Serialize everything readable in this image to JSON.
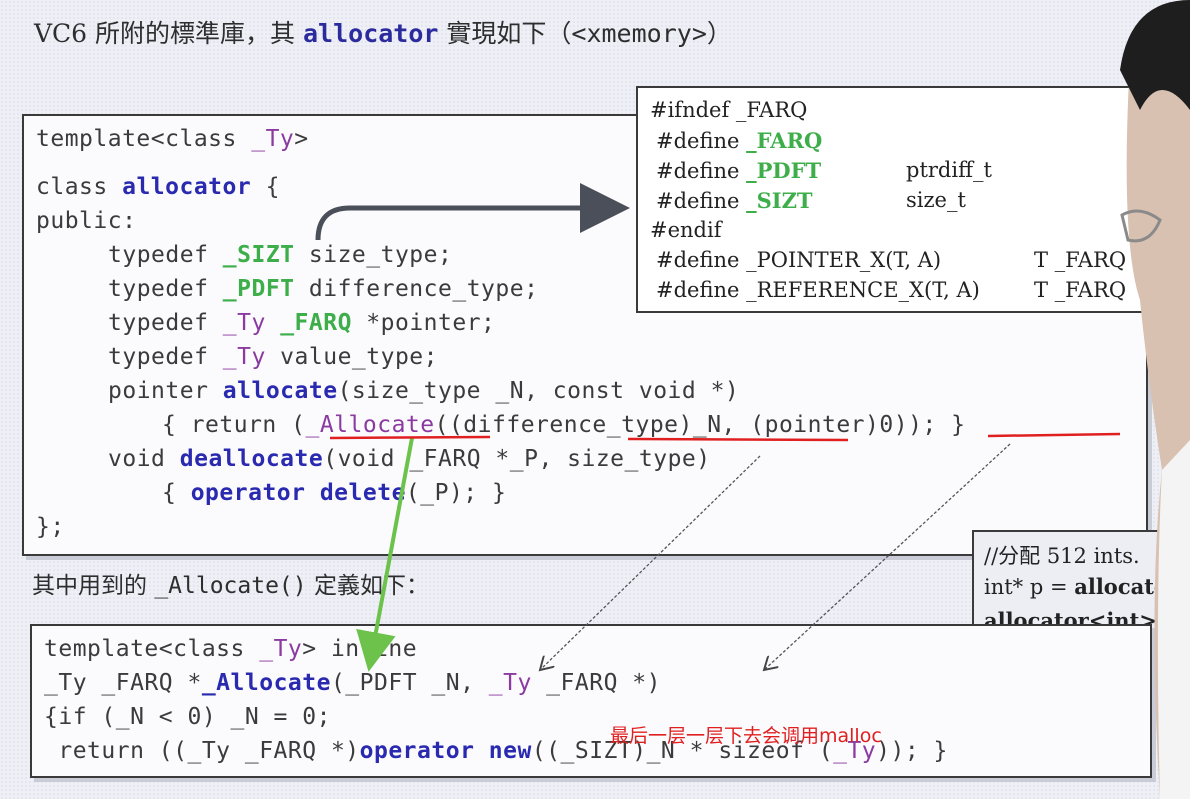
{
  "heading": {
    "prefix": "VC6 所附的標準庫，其 ",
    "keyword": "allocator",
    "mid": " 實現如下（",
    "file": "<xmemory>",
    "suffix": "）"
  },
  "main_code": {
    "l1a": "template<class ",
    "l1b": "_Ty",
    "l1c": ">",
    "l2a": "class ",
    "l2b": "allocator",
    "l2c": " {",
    "l3": "public:",
    "l4a": "typedef ",
    "l4b": "_SIZT",
    "l4c": " size_type;",
    "l5a": "typedef ",
    "l5b": "_PDFT",
    "l5c": " difference_type;",
    "l6a": "typedef ",
    "l6b": "_Ty",
    "l6c": " ",
    "l6d": "_FARQ",
    "l6e": " *pointer;",
    "l7a": "typedef ",
    "l7b": "_Ty",
    "l7c": " value_type;",
    "l8a": "pointer ",
    "l8b": "allocate",
    "l8c": "(size_type _N, const void *)",
    "l9a": "{ return (",
    "l9b": "_Allocate",
    "l9c": "((difference_type)_N, (pointer)0)); }",
    "l10a": "void ",
    "l10b": "deallocate",
    "l10c": "(void _FARQ *_P, size_type)",
    "l11a": "{ ",
    "l11b": "operator delete",
    "l11c": "(_P); }",
    "l12": "};"
  },
  "defines": {
    "d1": "#ifndef _FARQ",
    "d2a": "#define ",
    "d2b": "_FARQ",
    "d3a": "#define ",
    "d3b": "_PDFT",
    "d3c": "ptrdiff_t",
    "d4a": "#define ",
    "d4b": "_SIZT",
    "d4c": "size_t",
    "d5": "#endif",
    "d6a": "#define _POINTER_X(T, A)",
    "d6b": "T _FARQ",
    "d7a": "#define _REFERENCE_X(T, A)",
    "d7b": "T _FARQ"
  },
  "caption": {
    "a": "其中用到的 ",
    "b": "_Allocate()",
    "c": " 定義如下："
  },
  "bottom_code": {
    "b1a": "template<class ",
    "b1b": "_Ty",
    "b1c": "> inline",
    "b2a": "_Ty _FARQ *",
    "b2b": "_Allocate",
    "b2c": "(_PDFT _N, ",
    "b2d": "_Ty",
    "b2e": " _FARQ *)",
    "b3": "{if (_N < 0) _N = 0;",
    "b4a": " return ((_Ty _FARQ *)",
    "b4b": "operator new",
    "b4c": "((_SIZT)_N * sizeof (",
    "b4d": "_Ty",
    "b4e": ")); }"
  },
  "comment_box": {
    "c1": "//分配 512 ints.",
    "c2a": "int* p = ",
    "c2b": "allocator<",
    "c3": "allocator<int>().d"
  },
  "note": "最后一层一层下去会调用malloc",
  "colors": {
    "keyword": "#2a2ab0",
    "type": "#8a3aa0",
    "macro": "#3dae4a",
    "annotation": "#e02020",
    "arrow_green": "#6cc24a"
  }
}
